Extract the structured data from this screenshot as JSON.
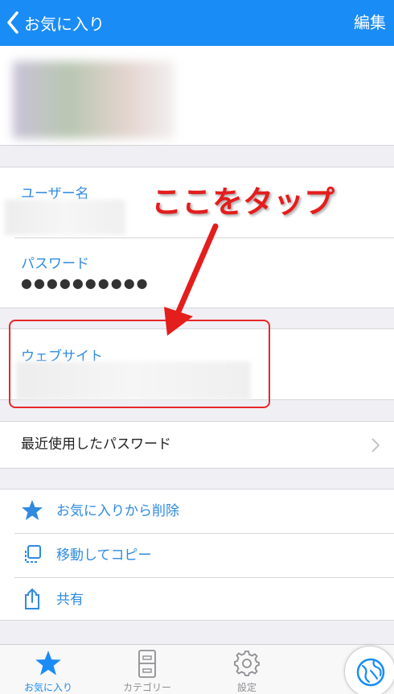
{
  "navbar": {
    "back_label": "お気に入り",
    "edit_label": "編集",
    "color": "#1a8cf5"
  },
  "fields": {
    "username_label": "ユーザー名",
    "password_label": "パスワード",
    "password_value": "●●●●●●●●●●",
    "website_label": "ウェブサイト"
  },
  "annotation": {
    "text": "ここをタップ",
    "color": "#e41d1d"
  },
  "recent": {
    "label": "最近使用したパスワード"
  },
  "actions": [
    {
      "label": "お気に入りから削除",
      "icon": "star-icon"
    },
    {
      "label": "移動してコピー",
      "icon": "copy-icon"
    },
    {
      "label": "共有",
      "icon": "share-icon"
    }
  ],
  "tabs": [
    {
      "label": "お気に入り",
      "icon": "star-icon",
      "active": true
    },
    {
      "label": "カテゴリー",
      "icon": "cabinet-icon",
      "active": false
    },
    {
      "label": "設定",
      "icon": "gear-icon",
      "active": false
    }
  ],
  "accent_color": "#2f8ae0"
}
